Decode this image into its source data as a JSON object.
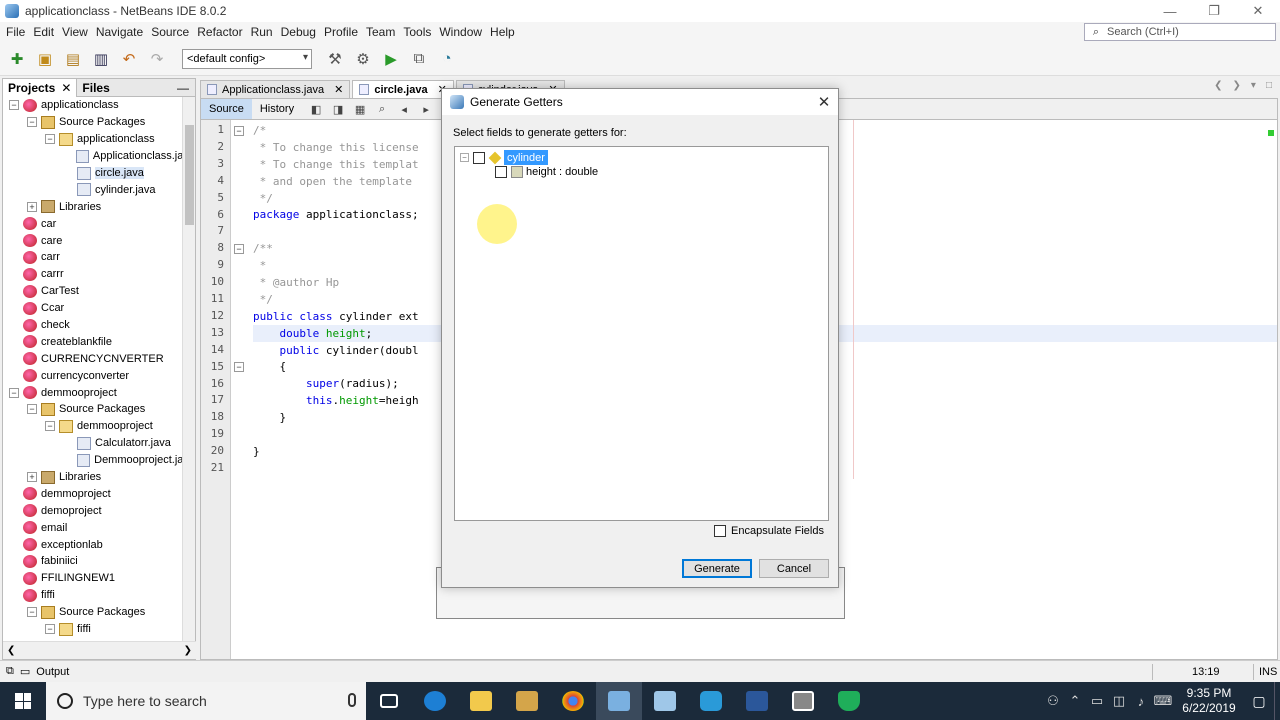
{
  "window": {
    "title": "applicationclass - NetBeans IDE 8.0.2",
    "buttons": [
      "—",
      "❐",
      "✕"
    ]
  },
  "menu": [
    "File",
    "Edit",
    "View",
    "Navigate",
    "Source",
    "Refactor",
    "Run",
    "Debug",
    "Profile",
    "Team",
    "Tools",
    "Window",
    "Help"
  ],
  "search": {
    "placeholder": "Search (Ctrl+I)"
  },
  "toolbar": {
    "config": "<default config>"
  },
  "left_panel": {
    "tabs": [
      "Projects",
      "Files"
    ],
    "close": "✕",
    "minimize": "—",
    "tree": [
      {
        "label": "applicationclass",
        "indent": 0,
        "icon": "proj",
        "exp": "−"
      },
      {
        "label": "Source Packages",
        "indent": 1,
        "icon": "pkg",
        "exp": "−"
      },
      {
        "label": "applicationclass",
        "indent": 2,
        "icon": "pkg2",
        "exp": "−"
      },
      {
        "label": "Applicationclass.java",
        "indent": 3,
        "icon": "java",
        "exp": ""
      },
      {
        "label": "circle.java",
        "indent": 3,
        "icon": "java",
        "exp": "",
        "selected": true
      },
      {
        "label": "cylinder.java",
        "indent": 3,
        "icon": "java",
        "exp": ""
      },
      {
        "label": "Libraries",
        "indent": 1,
        "icon": "lib",
        "exp": "+"
      },
      {
        "label": "car",
        "indent": 0,
        "icon": "proj",
        "exp": ""
      },
      {
        "label": "care",
        "indent": 0,
        "icon": "proj",
        "exp": ""
      },
      {
        "label": "carr",
        "indent": 0,
        "icon": "proj",
        "exp": ""
      },
      {
        "label": "carrr",
        "indent": 0,
        "icon": "proj",
        "exp": ""
      },
      {
        "label": "CarTest",
        "indent": 0,
        "icon": "proj",
        "exp": ""
      },
      {
        "label": "Ccar",
        "indent": 0,
        "icon": "proj",
        "exp": ""
      },
      {
        "label": "check",
        "indent": 0,
        "icon": "proj",
        "exp": ""
      },
      {
        "label": "createblankfile",
        "indent": 0,
        "icon": "proj",
        "exp": ""
      },
      {
        "label": "CURRENCYCNVERTER",
        "indent": 0,
        "icon": "proj",
        "exp": ""
      },
      {
        "label": "currencyconverter",
        "indent": 0,
        "icon": "proj",
        "exp": ""
      },
      {
        "label": "demmooproject",
        "indent": 0,
        "icon": "proj",
        "exp": "−"
      },
      {
        "label": "Source Packages",
        "indent": 1,
        "icon": "pkg",
        "exp": "−"
      },
      {
        "label": "demmooproject",
        "indent": 2,
        "icon": "pkg2",
        "exp": "−"
      },
      {
        "label": "Calculatorr.java",
        "indent": 3,
        "icon": "java",
        "exp": ""
      },
      {
        "label": "Demmooproject.java",
        "indent": 3,
        "icon": "java",
        "exp": ""
      },
      {
        "label": "Libraries",
        "indent": 1,
        "icon": "lib",
        "exp": "+"
      },
      {
        "label": "demmoproject",
        "indent": 0,
        "icon": "proj",
        "exp": ""
      },
      {
        "label": "demoproject",
        "indent": 0,
        "icon": "proj",
        "exp": ""
      },
      {
        "label": "email",
        "indent": 0,
        "icon": "proj",
        "exp": ""
      },
      {
        "label": "exceptionlab",
        "indent": 0,
        "icon": "proj",
        "exp": ""
      },
      {
        "label": "fabiniici",
        "indent": 0,
        "icon": "proj",
        "exp": ""
      },
      {
        "label": "FFILINGNEW1",
        "indent": 0,
        "icon": "proj",
        "exp": ""
      },
      {
        "label": "fiffi",
        "indent": 0,
        "icon": "proj",
        "exp": ""
      },
      {
        "label": "Source Packages",
        "indent": 1,
        "icon": "pkg",
        "exp": "−"
      },
      {
        "label": "fiffi",
        "indent": 2,
        "icon": "pkg2",
        "exp": "−"
      }
    ]
  },
  "editor": {
    "tabs": [
      {
        "label": "Applicationclass.java",
        "active": false
      },
      {
        "label": "circle.java",
        "active": true
      },
      {
        "label": "cylinder.java",
        "active": false
      }
    ],
    "subtabs": [
      "Source",
      "History"
    ],
    "lines": [
      "/*",
      " * To change this license",
      " * To change this templat",
      " * and open the template",
      " */",
      "package applicationclass;",
      "",
      "/**",
      " *",
      " * @author Hp",
      " */",
      "public class cylinder ext",
      "    double height;",
      "    public cylinder(doubl",
      "    {",
      "        super(radius);",
      "        this.height=heigh",
      "    }",
      "",
      "}",
      ""
    ]
  },
  "dialog": {
    "title": "Generate Getters",
    "instruction": "Select fields to generate getters for:",
    "tree_root": "cylinder",
    "tree_field": "height : double",
    "encapsulate_label": "Encapsulate Fields",
    "generate_label": "Generate",
    "cancel_label": "Cancel"
  },
  "status": {
    "output_label": "Output",
    "position": "13:19",
    "mode": "INS"
  },
  "taskbar": {
    "search_placeholder": "Type here to search",
    "time": "9:35 PM",
    "date": "6/22/2019"
  }
}
